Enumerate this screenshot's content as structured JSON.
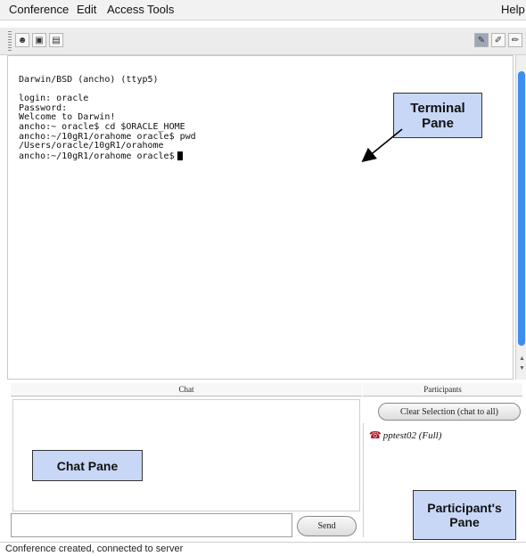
{
  "menu": {
    "items": [
      "Conference",
      "Edit",
      "Access",
      "Tools"
    ],
    "help": "Help"
  },
  "toolbar": {
    "left_icons": [
      "user-icon",
      "document-icon",
      "trash-icon"
    ],
    "right_icons": [
      "pen-icon",
      "brush-icon",
      "pen2-icon"
    ]
  },
  "terminal": {
    "lines": [
      "Darwin/BSD (ancho) (ttyp5)",
      "",
      "login: oracle",
      "Password:",
      "Welcome to Darwin!",
      "ancho:~ oracle$ cd $ORACLE_HOME",
      "ancho:~/10gR1/orahome oracle$ pwd",
      "/Users/oracle/10gR1/orahome",
      "ancho:~/10gR1/orahome oracle$"
    ],
    "callout": "Terminal Pane"
  },
  "chat": {
    "header": "Chat",
    "callout": "Chat Pane",
    "send_label": "Send"
  },
  "participants": {
    "header": "Participants",
    "clear_label": "Clear Selection (chat to all)",
    "items": [
      "pptest02 (Full)"
    ],
    "callout": "Participant's Pane"
  },
  "status": {
    "text": "Conference created, connected to server"
  },
  "colors": {
    "callout_bg": "#c7d7f5",
    "scroll_thumb": "#3d8df2"
  }
}
